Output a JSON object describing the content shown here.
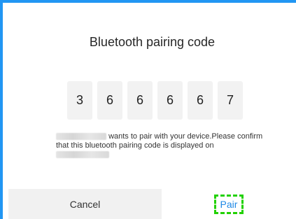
{
  "dialog": {
    "title": "Bluetooth pairing code",
    "code_digits": [
      "3",
      "6",
      "6",
      "6",
      "6",
      "7"
    ],
    "message_part1": "wants to pair with your device.Please confirm that this bluetooth pairing code is displayed",
    "message_part2": "on"
  },
  "buttons": {
    "cancel_label": "Cancel",
    "pair_label": "Pair"
  },
  "colors": {
    "accent": "#2196f3",
    "pair_text": "#1e88e5",
    "highlight": "#22d100",
    "cancel_bg": "#f1f1f1"
  }
}
